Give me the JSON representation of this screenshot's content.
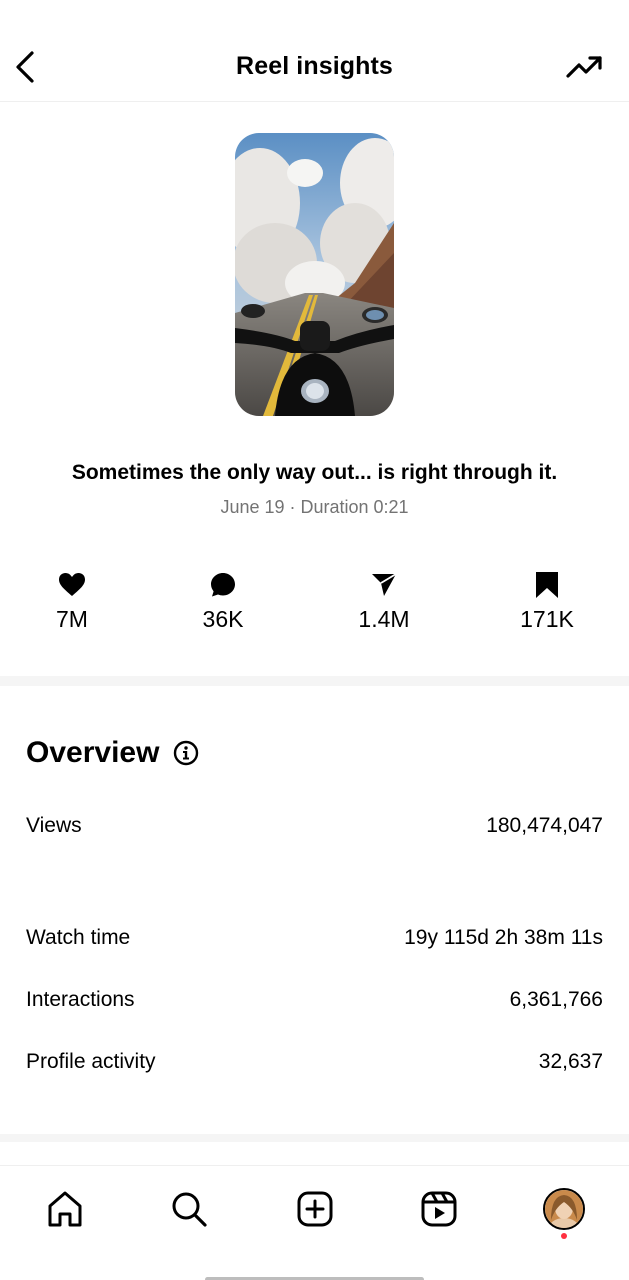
{
  "header": {
    "title": "Reel insights",
    "back_icon": "back-chevron-icon",
    "trend_icon": "trending-up-icon"
  },
  "reel": {
    "caption": "Sometimes the only way out... is right through it.",
    "meta": "June 19 · Duration 0:21",
    "thumbnail": "motorcycle-road-clouds-image"
  },
  "stats": [
    {
      "icon": "heart-icon",
      "value": "7M"
    },
    {
      "icon": "comment-icon",
      "value": "36K"
    },
    {
      "icon": "share-icon",
      "value": "1.4M"
    },
    {
      "icon": "bookmark-icon",
      "value": "171K"
    }
  ],
  "overview": {
    "title": "Overview",
    "info_icon": "info-icon",
    "rows": [
      {
        "label": "Views",
        "value": "180,474,047"
      },
      {
        "label": "Watch time",
        "value": "19y 115d 2h 38m 11s"
      },
      {
        "label": "Interactions",
        "value": "6,361,766"
      },
      {
        "label": "Profile activity",
        "value": "32,637"
      }
    ]
  },
  "tabbar": {
    "items": [
      "home-icon",
      "search-icon",
      "create-icon",
      "reels-icon",
      "profile-avatar"
    ],
    "notification_color": "#ff3040"
  }
}
